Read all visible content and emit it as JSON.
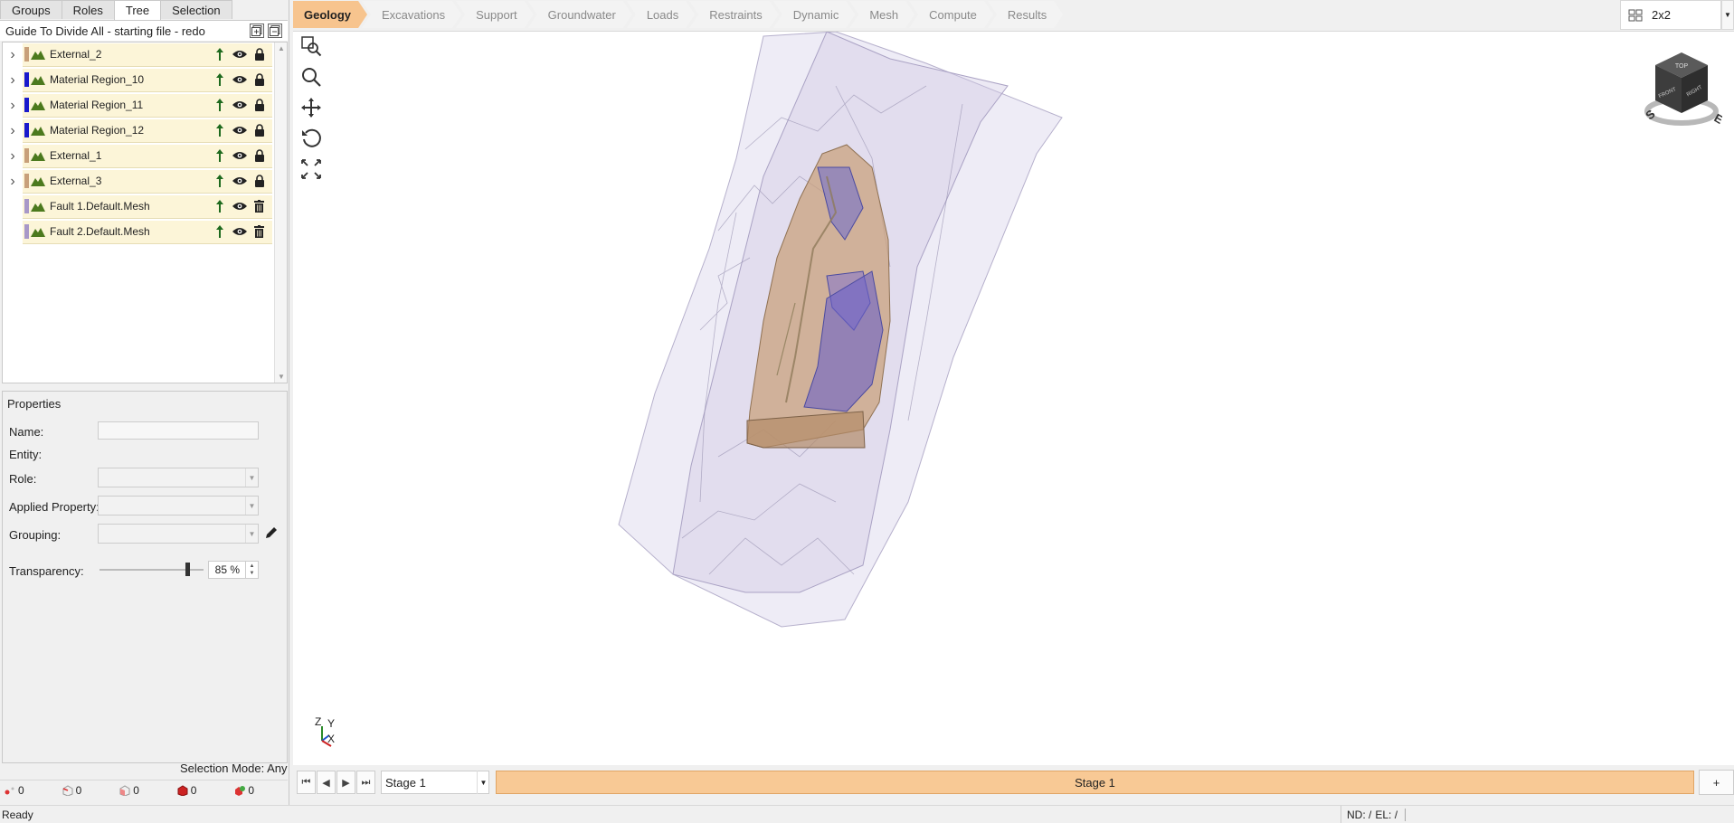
{
  "left_tabs": [
    "Groups",
    "Roles",
    "Tree",
    "Selection"
  ],
  "active_left_tab": "Tree",
  "tree": {
    "title": "Guide To Divide All - starting file - redo",
    "items": [
      {
        "label": "External_2",
        "color": "#c8a07a",
        "expandable": true,
        "last_icon": "lock"
      },
      {
        "label": "Material Region_10",
        "color": "#1a1acc",
        "expandable": true,
        "last_icon": "lock"
      },
      {
        "label": "Material Region_11",
        "color": "#1a1acc",
        "expandable": true,
        "last_icon": "lock"
      },
      {
        "label": "Material Region_12",
        "color": "#1a1acc",
        "expandable": true,
        "last_icon": "lock"
      },
      {
        "label": "External_1",
        "color": "#c8a07a",
        "expandable": true,
        "last_icon": "lock"
      },
      {
        "label": "External_3",
        "color": "#c8a07a",
        "expandable": true,
        "last_icon": "lock"
      },
      {
        "label": "Fault 1.Default.Mesh",
        "color": "#a898c8",
        "expandable": false,
        "last_icon": "trash"
      },
      {
        "label": "Fault 2.Default.Mesh",
        "color": "#a898c8",
        "expandable": false,
        "last_icon": "trash"
      }
    ]
  },
  "properties": {
    "title": "Properties",
    "name_label": "Name:",
    "name_value": "",
    "entity_label": "Entity:",
    "role_label": "Role:",
    "applied_property_label": "Applied Property:",
    "grouping_label": "Grouping:",
    "transparency_label": "Transparency:",
    "transparency_value": "85 %",
    "transparency_fraction": 0.85
  },
  "selection_mode": {
    "label": "Selection Mode:",
    "value": "Any"
  },
  "counters": [
    "0",
    "0",
    "0",
    "0",
    "0"
  ],
  "workflow_tabs": [
    "Geology",
    "Excavations",
    "Support",
    "Groundwater",
    "Loads",
    "Restraints",
    "Dynamic",
    "Mesh",
    "Compute",
    "Results"
  ],
  "active_workflow_tab": "Geology",
  "layout": {
    "label": "2x2"
  },
  "nav_cube": {
    "top": "TOP",
    "front": "FRONT",
    "right": "RIGHT",
    "south": "S",
    "east": "E"
  },
  "axes": {
    "z": "Z",
    "y": "Y",
    "x": "X"
  },
  "stage": {
    "selected": "Stage 1",
    "track_label": "Stage 1",
    "add_label": "+"
  },
  "status": {
    "text": "Ready",
    "nd": "ND: /",
    "el": "EL: /"
  },
  "colors": {
    "accent": "#f7c48e",
    "row_bg": "#fcf5d8",
    "stage_track": "#f8c995"
  }
}
